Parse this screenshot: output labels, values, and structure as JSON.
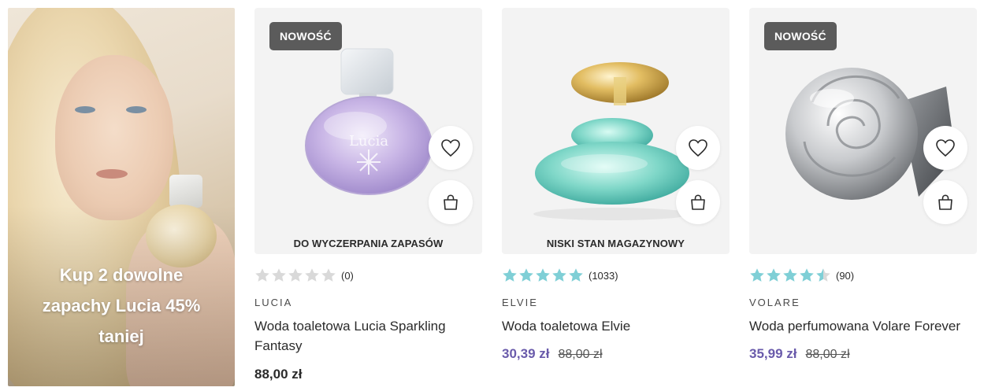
{
  "promo": {
    "text": "Kup 2 dowolne zapachy Lucia 45% taniej"
  },
  "colors": {
    "badge_bg": "#5b5b5b",
    "star_filled": "#7fcfd6",
    "star_empty": "#d9d9d9",
    "promo_price": "#6a5bab",
    "card_bg": "#f3f3f3"
  },
  "products": [
    {
      "badge": "NOWOŚĆ",
      "stock_label": "DO WYCZERPANIA ZAPASÓW",
      "rating": 0,
      "rating_count": "(0)",
      "brand": "LUCIA",
      "title": "Woda toaletowa Lucia Sparkling Fantasy",
      "price": "88,00 zł",
      "old_price": "",
      "wishlist_icon": "heart-icon",
      "cart_icon": "shopping-bag-icon"
    },
    {
      "badge": "",
      "stock_label": "NISKI STAN MAGAZYNOWY",
      "rating": 5,
      "rating_count": "(1033)",
      "brand": "ELVIE",
      "title": "Woda toaletowa Elvie",
      "price": "30,39 zł",
      "old_price": "88,00 zł",
      "wishlist_icon": "heart-icon",
      "cart_icon": "shopping-bag-icon"
    },
    {
      "badge": "NOWOŚĆ",
      "stock_label": "",
      "rating": 4.5,
      "rating_count": "(90)",
      "brand": "VOLARE",
      "title": "Woda perfumowana Volare Forever",
      "price": "35,99 zł",
      "old_price": "88,00 zł",
      "wishlist_icon": "heart-icon",
      "cart_icon": "shopping-bag-icon"
    }
  ]
}
